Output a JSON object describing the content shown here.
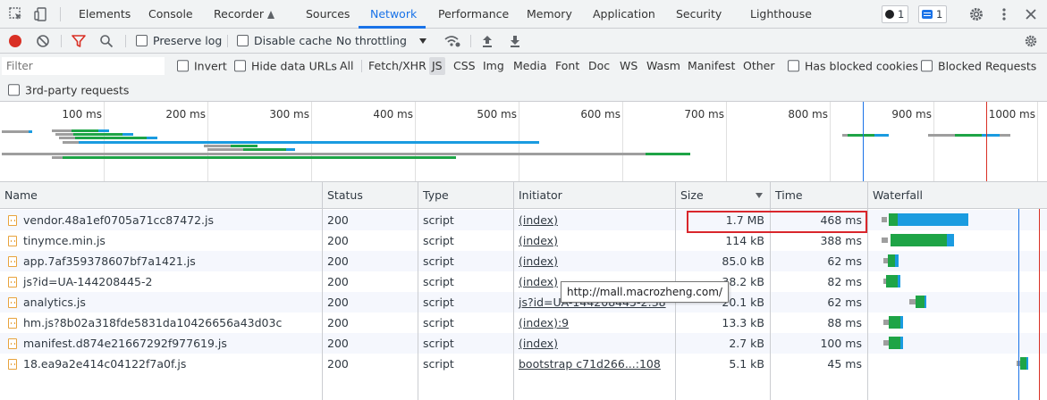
{
  "tabs": [
    "Elements",
    "Console",
    "Recorder",
    "Sources",
    "Network",
    "Performance",
    "Memory",
    "Application",
    "Security",
    "Lighthouse"
  ],
  "active_tab": "Network",
  "badges": {
    "issues_count": "1",
    "messages_count": "1"
  },
  "toolbar": {
    "preserve_log": "Preserve log",
    "disable_cache": "Disable cache",
    "throttling": "No throttling"
  },
  "filters": {
    "placeholder": "Filter",
    "invert": "Invert",
    "hide_data_urls": "Hide data URLs",
    "types": [
      "All",
      "Fetch/XHR",
      "JS",
      "CSS",
      "Img",
      "Media",
      "Font",
      "Doc",
      "WS",
      "Wasm",
      "Manifest",
      "Other"
    ],
    "selected_type": "JS",
    "has_blocked_cookies": "Has blocked cookies",
    "blocked_requests": "Blocked Requests",
    "third_party": "3rd-party requests"
  },
  "overview": {
    "tick_labels": [
      "100 ms",
      "200 ms",
      "300 ms",
      "400 ms",
      "500 ms",
      "600 ms",
      "700 ms",
      "800 ms",
      "900 ms",
      "1000 ms"
    ]
  },
  "table": {
    "columns": [
      "Name",
      "Status",
      "Type",
      "Initiator",
      "Size",
      "Time",
      "Waterfall"
    ],
    "rows": [
      {
        "name": "vendor.48a1ef0705a71cc87472.js",
        "status": "200",
        "type": "script",
        "initiator": "(index)",
        "size": "1.7 MB",
        "time": "468 ms"
      },
      {
        "name": "tinymce.min.js",
        "status": "200",
        "type": "script",
        "initiator": "(index)",
        "size": "114 kB",
        "time": "388 ms"
      },
      {
        "name": "app.7af359378607bf7a1421.js",
        "status": "200",
        "type": "script",
        "initiator": "(index)",
        "size": "85.0 kB",
        "time": "62 ms"
      },
      {
        "name": "js?id=UA-144208445-2",
        "status": "200",
        "type": "script",
        "initiator": "(index)",
        "size": "38.2 kB",
        "time": "82 ms"
      },
      {
        "name": "analytics.js",
        "status": "200",
        "type": "script",
        "initiator": "js?id=UA-144208445-2:38",
        "size": "20.1 kB",
        "time": "62 ms"
      },
      {
        "name": "hm.js?8b02a318fde5831da10426656a43d03c",
        "status": "200",
        "type": "script",
        "initiator": "(index):9",
        "size": "13.3 kB",
        "time": "88 ms"
      },
      {
        "name": "manifest.d874e21667292f977619.js",
        "status": "200",
        "type": "script",
        "initiator": "(index)",
        "size": "2.7 kB",
        "time": "100 ms"
      },
      {
        "name": "18.ea9a2e414c04122f7a0f.js",
        "status": "200",
        "type": "script",
        "initiator": "bootstrap c71d266...:108",
        "size": "5.1 kB",
        "time": "45 ms"
      }
    ]
  },
  "tooltip": "http://mall.macrozheng.com/",
  "colors": {
    "accent": "#1a73e8",
    "record": "#d93025",
    "download": "#1a9be0",
    "waiting": "#1ea446",
    "highlight": "#d9262c"
  }
}
